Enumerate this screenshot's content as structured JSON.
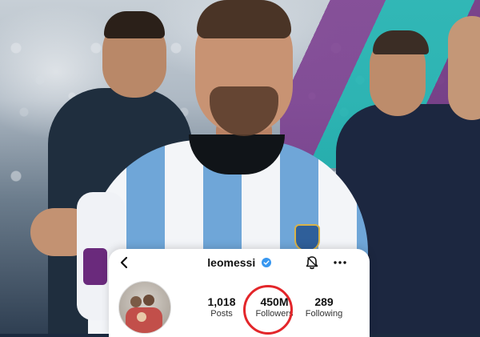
{
  "profile": {
    "username": "leomessi",
    "verified": true,
    "stats": [
      {
        "key": "posts",
        "value": "1,018",
        "label": "Posts"
      },
      {
        "key": "followers",
        "value": "450M",
        "label": "Followers"
      },
      {
        "key": "following",
        "value": "289",
        "label": "Following"
      }
    ]
  },
  "icons": {
    "back": "chevron-left-icon",
    "verified": "verified-badge-icon",
    "notifications": "bell-icon",
    "more": "more-horizontal-icon"
  },
  "colors": {
    "verified_blue": "#3897f0",
    "highlight_red": "#e3262a",
    "card_background": "#ffffff"
  }
}
